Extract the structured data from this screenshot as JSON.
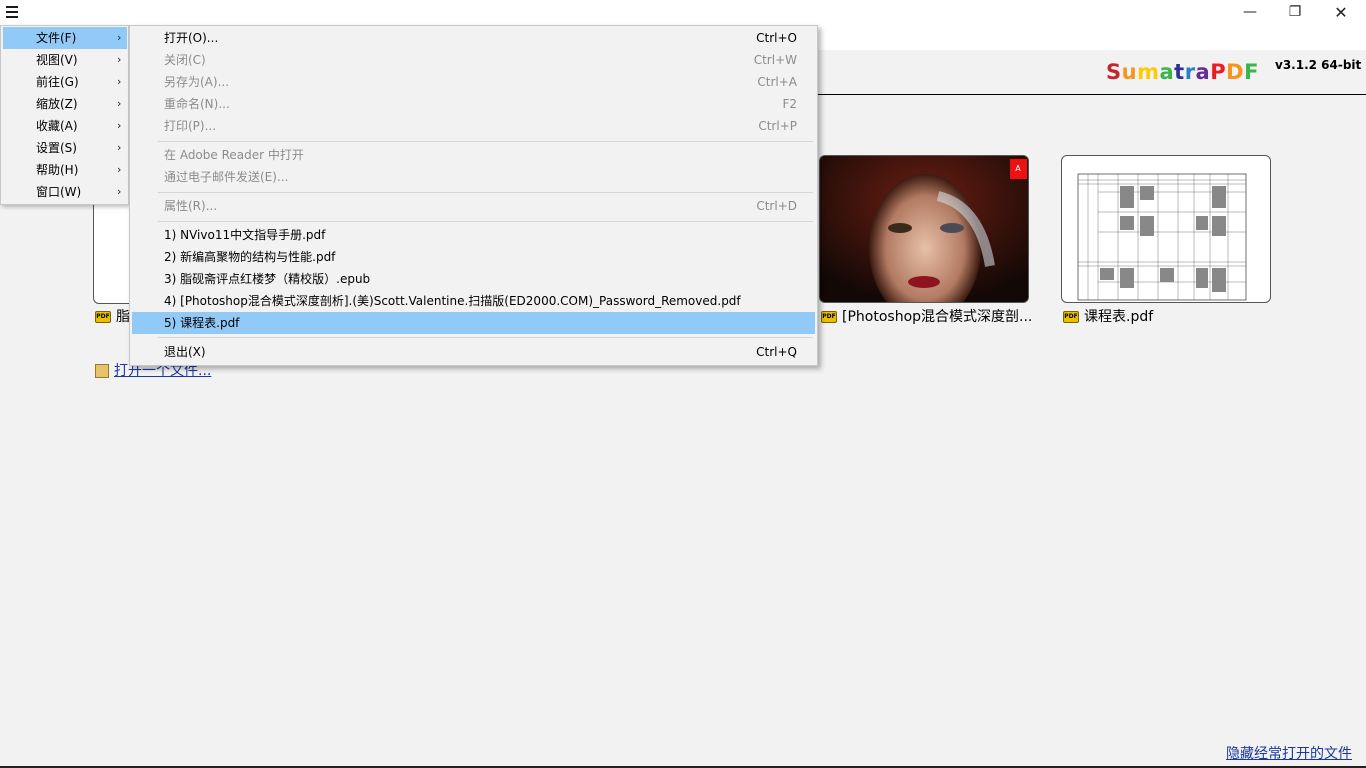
{
  "window": {
    "minimize_glyph": "—",
    "maximize_glyph": "❐",
    "close_glyph": "✕"
  },
  "app": {
    "logo": [
      "S",
      "u",
      "m",
      "a",
      "t",
      "r",
      "a",
      "P",
      "D",
      "F"
    ],
    "logo_colors": [
      "#c1272d",
      "#f7941d",
      "#ffcb05",
      "#39b54a",
      "#2e3192",
      "#2b7fc3",
      "#662d91",
      "#ed1c24",
      "#f7941d",
      "#39b54a"
    ],
    "version": "v3.1.2 64-bit"
  },
  "main_menu": {
    "items": [
      {
        "label": "文件(F)"
      },
      {
        "label": "视图(V)"
      },
      {
        "label": "前往(G)"
      },
      {
        "label": "缩放(Z)"
      },
      {
        "label": "收藏(A)"
      },
      {
        "label": "设置(S)"
      },
      {
        "label": "帮助(H)"
      },
      {
        "label": "窗口(W)"
      }
    ],
    "arrow": "›"
  },
  "file_menu": {
    "open": {
      "label": "打开(O)...",
      "shortcut": "Ctrl+O"
    },
    "close": {
      "label": "关闭(C)",
      "shortcut": "Ctrl+W"
    },
    "save_as": {
      "label": "另存为(A)...",
      "shortcut": "Ctrl+A"
    },
    "rename": {
      "label": "重命名(N)...",
      "shortcut": "F2"
    },
    "print": {
      "label": "打印(P)...",
      "shortcut": "Ctrl+P"
    },
    "open_in_adobe": {
      "label": "在 Adobe Reader 中打开"
    },
    "send_email": {
      "label": "通过电子邮件发送(E)..."
    },
    "properties": {
      "label": "属性(R)...",
      "shortcut": "Ctrl+D"
    },
    "recent": [
      "1) NVivo11中文指导手册.pdf",
      "2) 新编高聚物的结构与性能.pdf",
      "3) 脂砚斋评点红楼梦（精校版）.epub",
      "4) [Photoshop混合模式深度剖析].(美)Scott.Valentine.扫描版(ED2000.COM)_Password_Removed.pdf",
      "5) 课程表.pdf"
    ],
    "exit": {
      "label": "退出(X)",
      "shortcut": "Ctrl+Q"
    }
  },
  "home": {
    "thumbs": [
      {
        "caption": "脂"
      },
      {
        "caption": "[Photoshop混合模式深度剖..."
      },
      {
        "caption": "课程表.pdf"
      }
    ],
    "pdf_icon": "PDF",
    "open_file": "打开一个文件...",
    "hide_recent": "隐藏经常打开的文件"
  }
}
